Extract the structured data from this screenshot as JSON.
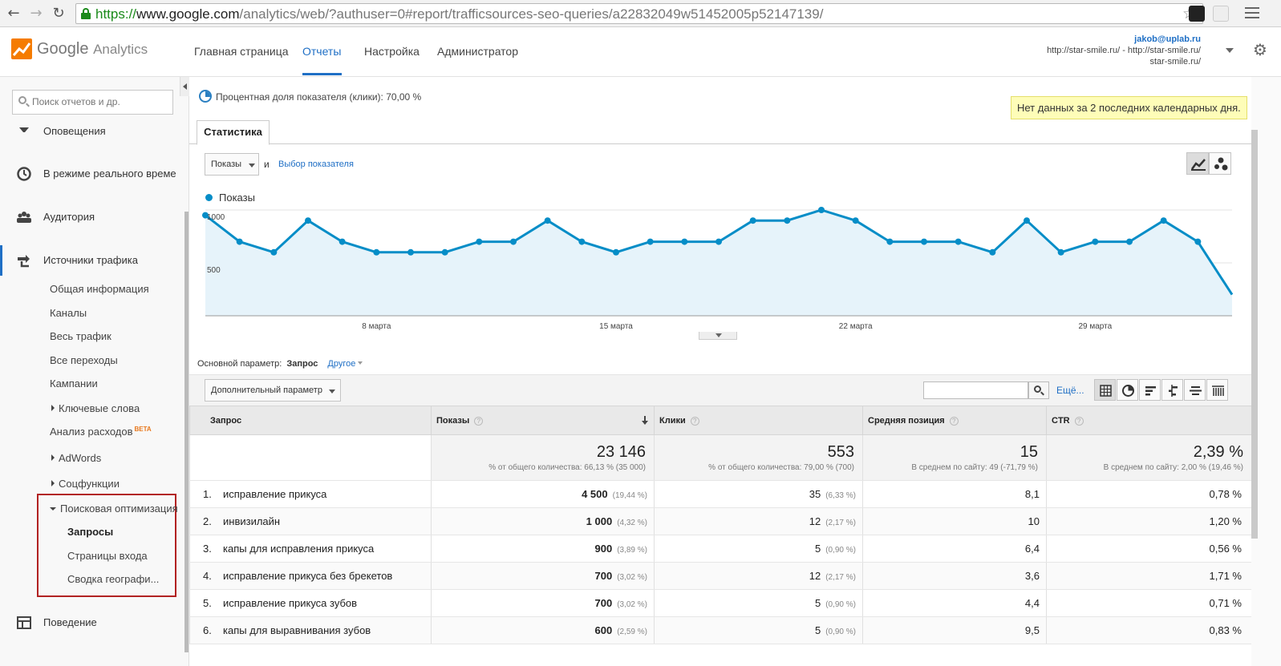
{
  "browser": {
    "url_scheme": "https://",
    "url_host": "www.google.com",
    "url_path": "/analytics/web/?authuser=0#report/trafficsources-seo-queries/a22832049w51452005p52147139/"
  },
  "header": {
    "logo_brand": "Google",
    "logo_product": "Analytics",
    "nav": [
      "Главная страница",
      "Отчеты",
      "Настройка",
      "Администратор"
    ],
    "active_nav": "Отчеты",
    "account_email": "jakob@uplab.ru",
    "account_property": "http://star-smile.ru/ - http://star-smile.ru/",
    "account_view": "star-smile.ru/"
  },
  "sidebar": {
    "search_placeholder": "Поиск отчетов и др.",
    "items": [
      {
        "label": "Оповещения",
        "icon": "megaphone-icon"
      },
      {
        "label": "В режиме реального времени",
        "icon": "clock-icon"
      },
      {
        "label": "Аудитория",
        "icon": "audience-icon"
      },
      {
        "label": "Источники трафика",
        "icon": "acquisition-icon"
      }
    ],
    "sub": {
      "overview": "Общая информация",
      "channels": "Каналы",
      "all_traffic": "Весь трафик",
      "referrals": "Все переходы",
      "campaigns": "Кампании",
      "keywords": "Ключевые слова",
      "cost_analysis": "Анализ расходов",
      "beta": "BETA",
      "adwords": "AdWords",
      "social": "Соцфункции",
      "seo": "Поисковая оптимизация",
      "queries": "Запросы",
      "landing": "Страницы входа",
      "geo": "Сводка географи..."
    },
    "behavior": {
      "label": "Поведение",
      "icon": "behavior-icon"
    }
  },
  "report": {
    "metric_note": "Процентная доля показателя (клики): 70,00 %",
    "no_data_notice": "Нет данных за 2 последних календарных дня.",
    "tab_label": "Статистика",
    "metric_select": "Показы",
    "and_label": "и",
    "choose_metric": "Выбор показателя",
    "primary_dimension_label": "Основной параметр:",
    "primary_dimension": "Запрос",
    "other_dimension": "Другое",
    "secondary_dimension": "Дополнительный параметр",
    "more_link": "Ещё..."
  },
  "colors": {
    "accent": "#1f6fc5",
    "series": "#058dc7",
    "area": "#e6f3fa",
    "notice_bg": "#fefdb8",
    "highlight_box": "#b22222"
  },
  "chart_data": {
    "type": "area",
    "series": [
      {
        "name": "Показы",
        "values": [
          950,
          700,
          600,
          900,
          700,
          600,
          600,
          600,
          700,
          700,
          900,
          700,
          600,
          700,
          700,
          700,
          900,
          900,
          1000,
          900,
          700,
          700,
          700,
          600,
          900,
          600,
          700,
          700,
          900,
          700,
          200
        ]
      }
    ],
    "y_ticks": [
      {
        "label": "1000",
        "value": 1000
      },
      {
        "label": "500",
        "value": 500
      }
    ],
    "ylim": [
      0,
      1000
    ],
    "x_tick_labels": [
      {
        "label": "8 марта",
        "index": 5
      },
      {
        "label": "15 марта",
        "index": 12
      },
      {
        "label": "22 марта",
        "index": 19
      },
      {
        "label": "29 марта",
        "index": 26
      }
    ],
    "grid": true
  },
  "table": {
    "headers": [
      "Запрос",
      "Показы",
      "Клики",
      "Средняя позиция",
      "CTR"
    ],
    "totals": [
      {
        "value": "23 146",
        "note": "% от общего количества: 66,13 % (35 000)"
      },
      {
        "value": "553",
        "note": "% от общего количества: 79,00 % (700)"
      },
      {
        "value": "15",
        "note": "В среднем по сайту: 49 (-71,79 %)"
      },
      {
        "value": "2,39 %",
        "note": "В среднем по сайту: 2,00 % (19,46 %)"
      }
    ],
    "rows": [
      {
        "rank": "1.",
        "query": "исправление прикуса",
        "impr": "4 500",
        "impr_pct": "(19,44 %)",
        "clicks": "35",
        "clicks_pct": "(6,33 %)",
        "pos": "8,1",
        "ctr": "0,78 %"
      },
      {
        "rank": "2.",
        "query": "инвизилайн",
        "impr": "1 000",
        "impr_pct": "(4,32 %)",
        "clicks": "12",
        "clicks_pct": "(2,17 %)",
        "pos": "10",
        "ctr": "1,20 %"
      },
      {
        "rank": "3.",
        "query": "капы для исправления прикуса",
        "impr": "900",
        "impr_pct": "(3,89 %)",
        "clicks": "5",
        "clicks_pct": "(0,90 %)",
        "pos": "6,4",
        "ctr": "0,56 %"
      },
      {
        "rank": "4.",
        "query": "исправление прикуса без брекетов",
        "impr": "700",
        "impr_pct": "(3,02 %)",
        "clicks": "12",
        "clicks_pct": "(2,17 %)",
        "pos": "3,6",
        "ctr": "1,71 %"
      },
      {
        "rank": "5.",
        "query": "исправление прикуса зубов",
        "impr": "700",
        "impr_pct": "(3,02 %)",
        "clicks": "5",
        "clicks_pct": "(0,90 %)",
        "pos": "4,4",
        "ctr": "0,71 %"
      },
      {
        "rank": "6.",
        "query": "капы для выравнивания зубов",
        "impr": "600",
        "impr_pct": "(2,59 %)",
        "clicks": "5",
        "clicks_pct": "(0,90 %)",
        "pos": "9,5",
        "ctr": "0,83 %"
      }
    ]
  }
}
